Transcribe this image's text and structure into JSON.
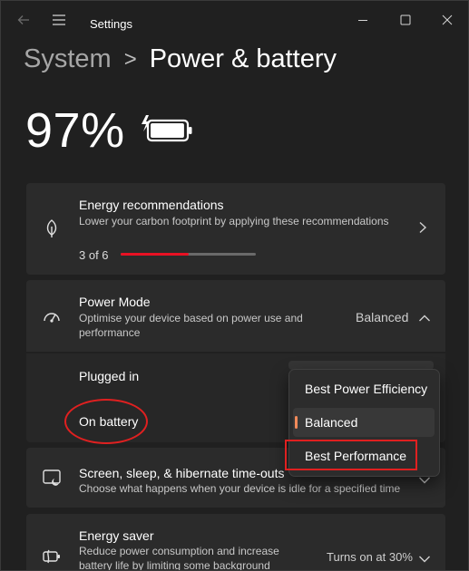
{
  "app": {
    "title": "Settings"
  },
  "breadcrumb": {
    "parent": "System",
    "separator": ">",
    "current": "Power & battery"
  },
  "battery": {
    "percent_label": "97%",
    "level": 0.97,
    "charging": true
  },
  "energy_recommendations": {
    "title": "Energy recommendations",
    "description": "Lower your carbon footprint by applying these recommendations",
    "progress_label": "3 of 6",
    "progress_fraction": 0.5,
    "progress_color": "#e81123"
  },
  "power_mode": {
    "title": "Power Mode",
    "description": "Optimise your device based on power use and performance",
    "value": "Balanced",
    "plugged_in_label": "Plugged in",
    "on_battery_label": "On battery",
    "options": [
      "Best Power Efficiency",
      "Balanced",
      "Best Performance"
    ],
    "selected_index": 1,
    "accent_color": "#f28a5a"
  },
  "sleep": {
    "title": "Screen, sleep, & hibernate time-outs",
    "description": "Choose what happens when your device is idle for a specified time"
  },
  "energy_saver": {
    "title": "Energy saver",
    "description": "Reduce power consumption and increase battery life by limiting some background",
    "value": "Turns on at 30%"
  },
  "annotation_color": "#e02020",
  "icons": {
    "back": "back-arrow-icon",
    "menu": "hamburger-menu-icon",
    "minimize": "minimize-icon",
    "maximize": "maximize-icon",
    "close": "close-icon",
    "leaf": "leaf-icon",
    "gauge": "gauge-icon",
    "sleep": "screen-sleep-icon",
    "saver": "energy-saver-icon"
  }
}
